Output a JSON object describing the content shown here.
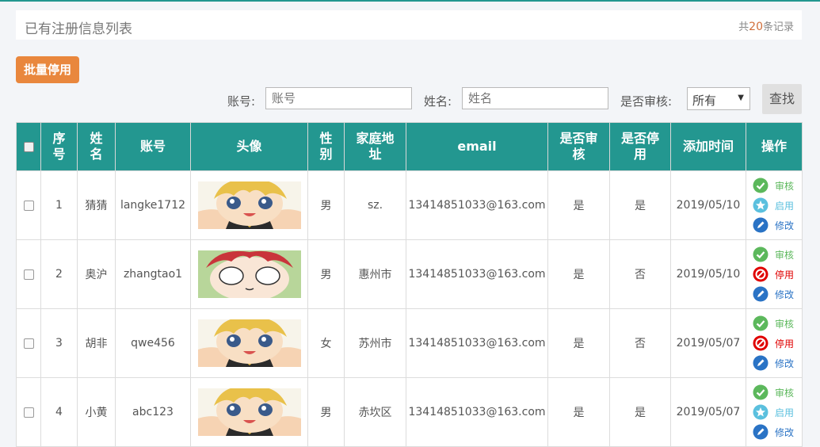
{
  "header": {
    "title": "已有注册信息列表",
    "count_prefix": "共",
    "count": "20",
    "count_suffix": "条记录"
  },
  "toolbar": {
    "batch_label": "批量停用"
  },
  "search": {
    "account_label": "账号:",
    "account_placeholder": "账号",
    "name_label": "姓名:",
    "name_placeholder": "姓名",
    "audit_label": "是否审核:",
    "audit_selected": "所有",
    "submit_label": "查找"
  },
  "table": {
    "columns": [
      "序号",
      "姓名",
      "账号",
      "头像",
      "性别",
      "家庭地址",
      "email",
      "是否审核",
      "是否停用",
      "添加时间",
      "操作"
    ],
    "rows": [
      {
        "no": "1",
        "name": "猜猜",
        "account": "langke1712",
        "gender": "男",
        "address": "sz.",
        "email": "13414851033@163.com",
        "audited": "是",
        "disabled": "是",
        "added": "2019/05/10",
        "ops": [
          "审核",
          "启用",
          "修改"
        ],
        "avatar": "blond"
      },
      {
        "no": "2",
        "name": "奥沪",
        "account": "zhangtao1",
        "gender": "男",
        "address": "惠州市",
        "email": "13414851033@163.com",
        "audited": "是",
        "disabled": "否",
        "added": "2019/05/10",
        "ops": [
          "审核",
          "停用",
          "修改"
        ],
        "avatar": "red"
      },
      {
        "no": "3",
        "name": "胡非",
        "account": "qwe456",
        "gender": "女",
        "address": "苏州市",
        "email": "13414851033@163.com",
        "audited": "是",
        "disabled": "否",
        "added": "2019/05/07",
        "ops": [
          "审核",
          "停用",
          "修改"
        ],
        "avatar": "blond"
      },
      {
        "no": "4",
        "name": "小黄",
        "account": "abc123",
        "gender": "男",
        "address": "赤坎区",
        "email": "13414851033@163.com",
        "audited": "是",
        "disabled": "是",
        "added": "2019/05/07",
        "ops": [
          "审核",
          "启用",
          "修改"
        ],
        "avatar": "blond"
      }
    ]
  },
  "colors": {
    "header_bg": "#239790",
    "batch_bg": "#e9873d",
    "audit": "#5cb85c",
    "enable": "#5bc0de",
    "disable": "#e00000",
    "edit": "#2a73c5"
  },
  "icons": {
    "audit": "check-circle-icon",
    "enable": "star-icon",
    "disable": "ban-icon",
    "edit": "pencil-icon"
  }
}
